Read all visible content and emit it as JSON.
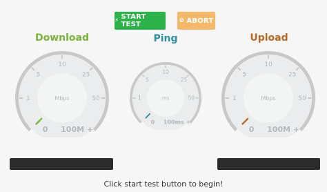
{
  "toolbar": {
    "start_label": "START TEST",
    "start_icon": "bolt-icon",
    "abort_label": "ABORT",
    "abort_icon": "ban-icon"
  },
  "gauges": {
    "download": {
      "title": "Download",
      "unit": "Mbps",
      "ticks": [
        "0",
        "1",
        "5",
        "10",
        "25",
        "50",
        "100M +"
      ],
      "value": 0
    },
    "ping": {
      "title": "Ping",
      "unit": "ms",
      "ticks": [
        "0",
        "1",
        "5",
        "10",
        "25",
        "50",
        "100ms +"
      ],
      "value": 0
    },
    "upload": {
      "title": "Upload",
      "unit": "Mbps",
      "ticks": [
        "0",
        "1",
        "5",
        "10",
        "25",
        "50",
        "100M +"
      ],
      "value": 0
    }
  },
  "status_text": "Click start test button to begin!",
  "colors": {
    "download": "#7ab23a",
    "ping": "#2e8fa1",
    "upload": "#b86a24",
    "start_button": "#2db14a",
    "abort_button": "#f3b86a",
    "arc": "#c8c8c8",
    "dial_face": "#eaeced",
    "progress_bar": "#2b2b2b"
  }
}
